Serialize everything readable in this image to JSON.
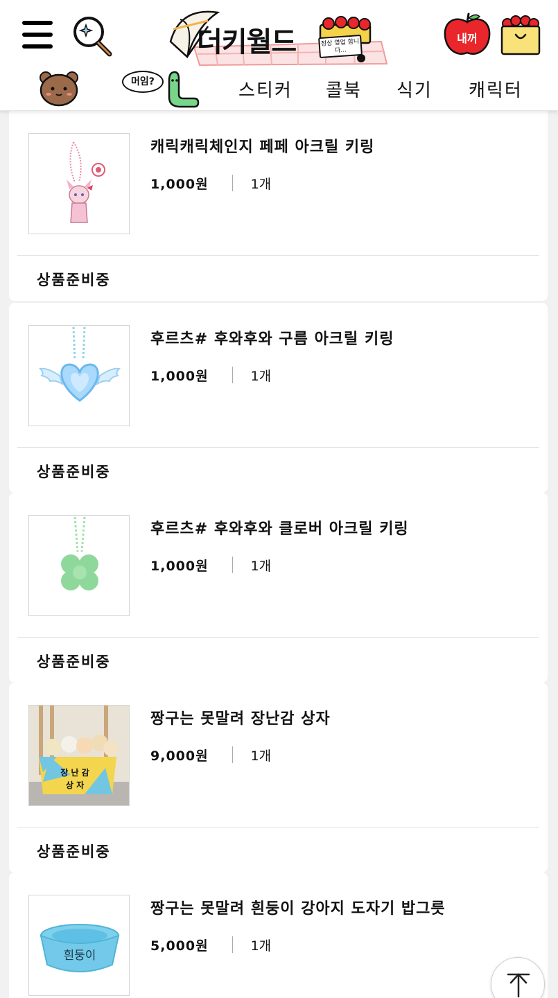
{
  "header": {
    "logo_text": "더키월드",
    "logo_sign": "정상 영업 합니다...",
    "my_button": "내꺼",
    "nav": {
      "bubble_text": "머임?",
      "items": [
        "스티커",
        "콜북",
        "식기",
        "캐릭터"
      ]
    }
  },
  "products": [
    {
      "name": "캐릭캐릭체인지 페페 아크릴 키링",
      "price": "1,000원",
      "qty": "1개",
      "status": "상품준비중"
    },
    {
      "name": "후르츠# 후와후와 구름 아크릴 키링",
      "price": "1,000원",
      "qty": "1개",
      "status": "상품준비중"
    },
    {
      "name": "후르츠# 후와후와 클로버 아크릴 키링",
      "price": "1,000원",
      "qty": "1개",
      "status": "상품준비중"
    },
    {
      "name": "짱구는 못말려 장난감 상자",
      "price": "9,000원",
      "qty": "1개",
      "status": "상품준비중",
      "image_text": [
        "장 난 감",
        "상 자"
      ]
    },
    {
      "name": "짱구는 못말려 흰둥이 강아지 도자기 밥그릇",
      "price": "5,000원",
      "qty": "1개",
      "image_text": "흰둥이"
    }
  ],
  "colors": {
    "apple_red": "#e8262b",
    "bag_yellow": "#f9e27a",
    "worm_green": "#77d68a",
    "bear_brown": "#9a6a4a"
  },
  "icons": [
    "menu-icon",
    "search-icon",
    "apple-icon",
    "shopping-bag-icon",
    "bear-icon",
    "worm-icon",
    "arrow-up-icon"
  ]
}
